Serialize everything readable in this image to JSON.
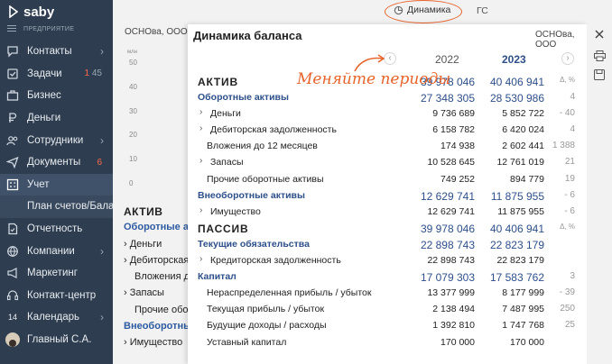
{
  "brand": {
    "name": "saby",
    "org_caption": "ПРЕДПРИЯТИЕ"
  },
  "sidebar": {
    "items": [
      {
        "label": "Контакты",
        "icon": "chat-icon",
        "chevron": "›"
      },
      {
        "label": "Задачи",
        "icon": "tasks-icon",
        "badge_red": "1",
        "badge_grey": "45"
      },
      {
        "label": "Бизнес",
        "icon": "business-icon"
      },
      {
        "label": "Деньги",
        "icon": "ruble-icon"
      },
      {
        "label": "Сотрудники",
        "icon": "people-icon",
        "chevron": "›"
      },
      {
        "label": "Документы",
        "icon": "send-icon",
        "badge_red": "6"
      },
      {
        "label": "Учет",
        "icon": "accounting-icon",
        "active": true
      },
      {
        "label": "План счетов/Бала",
        "sub": true
      },
      {
        "label": "Отчетность",
        "icon": "report-icon"
      },
      {
        "label": "Компании",
        "icon": "globe-icon",
        "chevron": "›"
      },
      {
        "label": "Маркетинг",
        "icon": "megaphone-icon"
      },
      {
        "label": "Контакт-центр",
        "icon": "headset-icon"
      },
      {
        "label": "Календарь",
        "icon": "calendar-icon",
        "icon_text": "14",
        "chevron": "›"
      },
      {
        "label": "Главный С.А.",
        "icon": "avatar-icon"
      }
    ]
  },
  "background": {
    "org": "ОСНОва, ООО",
    "chart_unit": "млн",
    "chart_ticks": [
      "50",
      "40",
      "30",
      "20",
      "10",
      "0"
    ],
    "rows": [
      {
        "text": "АКТИВ",
        "style": "h"
      },
      {
        "text": "Оборотные акт",
        "style": "blue"
      },
      {
        "text": "› Деньги",
        "style": "i1"
      },
      {
        "text": "› Дебиторская",
        "style": "i1"
      },
      {
        "text": "Вложения до",
        "style": "i2"
      },
      {
        "text": "› Запасы",
        "style": "i1"
      },
      {
        "text": "Прочие обор",
        "style": "i2"
      },
      {
        "text": "Внеоборотные",
        "style": "blue"
      },
      {
        "text": "› Имущество",
        "style": "i1"
      }
    ]
  },
  "topbar": {
    "dinamika": "Динамика",
    "extra": "ГС"
  },
  "panel": {
    "title": "Динамика баланса",
    "org": "ОСНОва, ООО",
    "prev": "‹",
    "next": "›",
    "years": [
      "2022",
      "2023"
    ],
    "hint": "Меняйте периоды",
    "rows": [
      {
        "kind": "section",
        "label": "АКТИВ",
        "v1": "39 978 046",
        "v2": "40 406 941",
        "d": "Δ, %"
      },
      {
        "kind": "group",
        "label": "Оборотные активы",
        "v1": "27 348 305",
        "v2": "28 530 986",
        "d": "4"
      },
      {
        "kind": "item",
        "caret": true,
        "label": "Деньги",
        "v1": "9 736 689",
        "v2": "5 852 722",
        "d": "- 40"
      },
      {
        "kind": "item",
        "caret": true,
        "label": "Дебиторская задолженность",
        "v1": "6 158 782",
        "v2": "6 420 024",
        "d": "4"
      },
      {
        "kind": "item",
        "caret": false,
        "label": "Вложения до 12 месяцев",
        "v1": "174 938",
        "v2": "2 602 441",
        "d": "1 388"
      },
      {
        "kind": "item",
        "caret": true,
        "label": "Запасы",
        "v1": "10 528 645",
        "v2": "12 761 019",
        "d": "21"
      },
      {
        "kind": "item",
        "caret": false,
        "label": "Прочие оборотные активы",
        "v1": "749 252",
        "v2": "894 779",
        "d": "19"
      },
      {
        "kind": "group",
        "label": "Внеоборотные активы",
        "v1": "12 629 741",
        "v2": "11 875 955",
        "d": "- 6"
      },
      {
        "kind": "item",
        "caret": true,
        "label": "Имущество",
        "v1": "12 629 741",
        "v2": "11 875 955",
        "d": "- 6"
      },
      {
        "kind": "section",
        "label": "ПАССИВ",
        "v1": "39 978 046",
        "v2": "40 406 941",
        "d": "Δ, %"
      },
      {
        "kind": "group",
        "label": "Текущие обязательства",
        "v1": "22 898 743",
        "v2": "22 823 179",
        "d": ""
      },
      {
        "kind": "item",
        "caret": true,
        "label": "Кредиторская задолженность",
        "v1": "22 898 743",
        "v2": "22 823 179",
        "d": ""
      },
      {
        "kind": "group",
        "label": "Капитал",
        "v1": "17 079 303",
        "v2": "17 583 762",
        "d": "3"
      },
      {
        "kind": "item",
        "caret": false,
        "label": "Нераспределенная прибыль / убыток",
        "v1": "13 377 999",
        "v2": "8 177 999",
        "d": "- 39"
      },
      {
        "kind": "item",
        "caret": false,
        "label": "Текущая прибыль / убыток",
        "v1": "2 138 494",
        "v2": "7 487 995",
        "d": "250"
      },
      {
        "kind": "item",
        "caret": false,
        "label": "Будущие доходы / расходы",
        "v1": "1 392 810",
        "v2": "1 747 768",
        "d": "25"
      },
      {
        "kind": "item",
        "caret": false,
        "label": "Уставный капитал",
        "v1": "170 000",
        "v2": "170 000",
        "d": ""
      }
    ]
  },
  "colors": {
    "sidebar": "#2e3d4f",
    "accent": "#e8632a",
    "link": "#2d4f8a"
  }
}
